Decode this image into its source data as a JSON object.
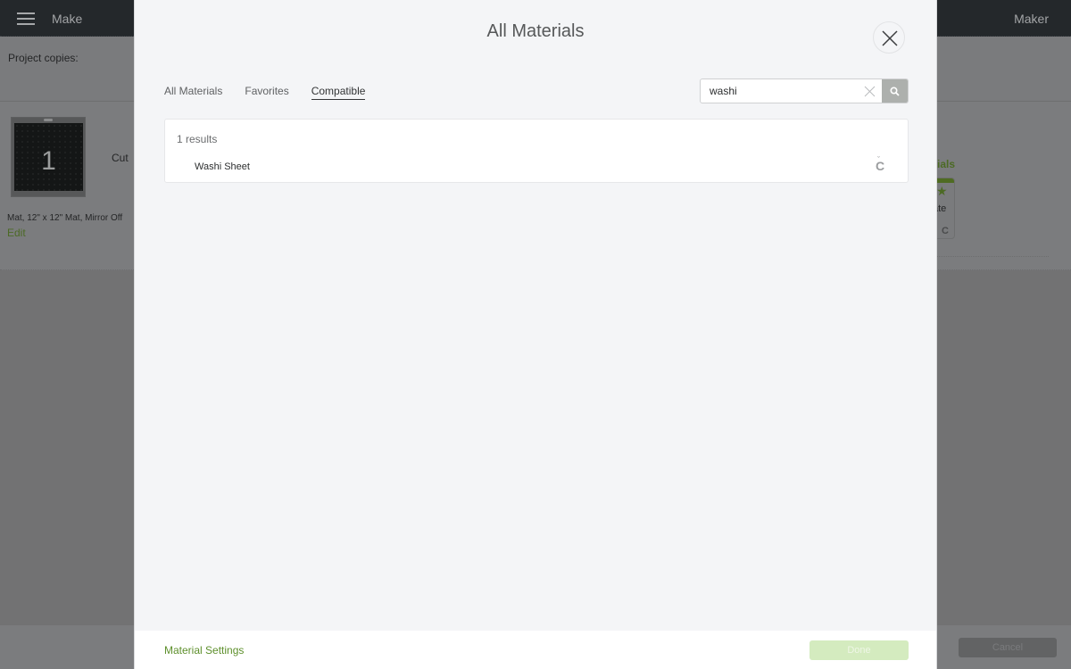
{
  "app": {
    "nav_title": "Make",
    "machine_name": "Maker",
    "project_copies_label": "Project copies:",
    "mat": {
      "number": "1",
      "action": "Cut",
      "description": "Mat, 12\" x 12\" Mat, Mirror Off",
      "edit_label": "Edit"
    },
    "right_panel": {
      "materials_label_partial": "ials",
      "card_text_partial": "ate",
      "card_badge": "C"
    },
    "cancel_label": "Cancel"
  },
  "modal": {
    "title": "All Materials",
    "tabs": [
      {
        "label": "All Materials",
        "active": false
      },
      {
        "label": "Favorites",
        "active": false
      },
      {
        "label": "Compatible",
        "active": true
      }
    ],
    "search": {
      "value": "washi",
      "placeholder": "Search"
    },
    "results": {
      "count_text": "1 results",
      "items": [
        {
          "name": "Washi Sheet",
          "icon": "C"
        }
      ]
    },
    "footer": {
      "material_settings_label": "Material Settings",
      "done_label": "Done"
    },
    "colors": {
      "accent_green": "#5d8f2b",
      "done_disabled": "#d4ebbf"
    }
  }
}
